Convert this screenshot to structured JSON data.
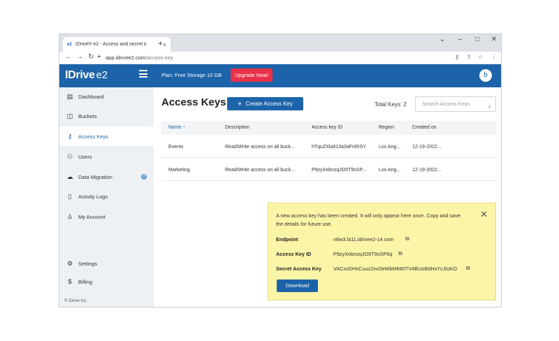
{
  "browser": {
    "tab_title": "IDrive® e2 - Access and secret k",
    "tab_favicon": "e2",
    "tab_close": "×",
    "new_tab": "+",
    "url_host": "app.idrivee2.com",
    "url_path": "/access-key",
    "win_minimize": "–",
    "win_maximize": "□",
    "win_close": "✕",
    "win_dropdown": "⌄"
  },
  "header": {
    "logo": "IDrive",
    "logo_suffix": "e2",
    "plan": "Plan: Free Storage 10 GB",
    "upgrade_label": "Upgrade Now!",
    "avatar_letter": "b",
    "color": "#1d63a9"
  },
  "sidebar": {
    "items": [
      {
        "label": "Dashboard",
        "icon": "dashboard-icon"
      },
      {
        "label": "Buckets",
        "icon": "bucket-icon"
      },
      {
        "label": "Access Keys",
        "icon": "key-icon"
      },
      {
        "label": "Users",
        "icon": "users-icon"
      },
      {
        "label": "Data Migration",
        "icon": "cloud-icon"
      },
      {
        "label": "Activity Logs",
        "icon": "log-icon"
      },
      {
        "label": "My Account",
        "icon": "user-icon"
      },
      {
        "label": "Settings",
        "icon": "gear-icon"
      },
      {
        "label": "Billing",
        "icon": "dollar-icon"
      }
    ],
    "help": "?",
    "copyright": "© IDrive Inc."
  },
  "main": {
    "title": "Access Keys",
    "create_label": "Create Access Key",
    "total_keys": "Total Keys: 2",
    "search_placeholder": "Search Access Keys",
    "columns": [
      "Name",
      "Description",
      "Access key ID",
      "Region",
      "Created on"
    ],
    "rows": [
      [
        "Events",
        "Read/Write access on all buck...",
        "hTquZXla913a3aFnRiSY",
        "Los Ang...",
        "12-19-2022..."
      ],
      [
        "Marketing",
        "Read/Write access on all buck...",
        "P9zyXebnzqJO5T9sSP...",
        "Los Ang...",
        "12-19-2022..."
      ]
    ]
  },
  "notice": {
    "message": "A new access key has been created. It will only appear here once. Copy and save the details for future use.",
    "endpoint_label": "Endpoint",
    "endpoint_value": "n8w3.la11.idrivee2-14.com",
    "key_id_label": "Access Key ID",
    "key_id_value": "P9zyXebnzqJO5T9sSP6q",
    "secret_label": "Secret Access Key",
    "secret_value": "VACsvDHxCuuz2xvDeWbM680TV4BUoBdHsYcJIoKO",
    "download_label": "Download",
    "background": "#fbf5a7"
  }
}
